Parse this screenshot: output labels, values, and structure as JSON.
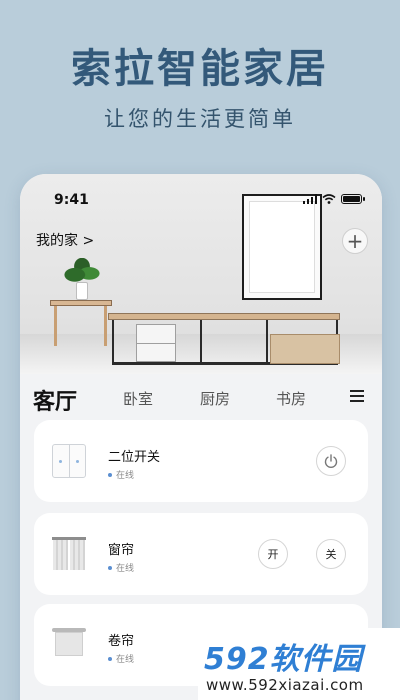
{
  "promo": {
    "title": "索拉智能家居",
    "subtitle": "让您的生活更简单"
  },
  "status_bar": {
    "time": "9:41"
  },
  "header": {
    "home_label": "我的家 >",
    "add_symbol": "+"
  },
  "tabs": {
    "active": "客厅",
    "items": [
      "卧室",
      "厨房",
      "书房"
    ]
  },
  "devices": [
    {
      "name": "二位开关",
      "status": "在线",
      "icon": "double-switch-icon",
      "controls": []
    },
    {
      "name": "窗帘",
      "status": "在线",
      "icon": "curtain-icon",
      "controls": [
        "开",
        "关"
      ]
    },
    {
      "name": "卷帘",
      "status": "在线",
      "icon": "roller-blind-icon",
      "controls": []
    }
  ],
  "watermark": {
    "brand": "592软件园",
    "url": "www.592xiazai.com"
  },
  "colors": {
    "background": "#b9cdda",
    "title": "#33597a",
    "status_dot": "#5b8fd1",
    "watermark_blue": "#2f7fd4"
  }
}
